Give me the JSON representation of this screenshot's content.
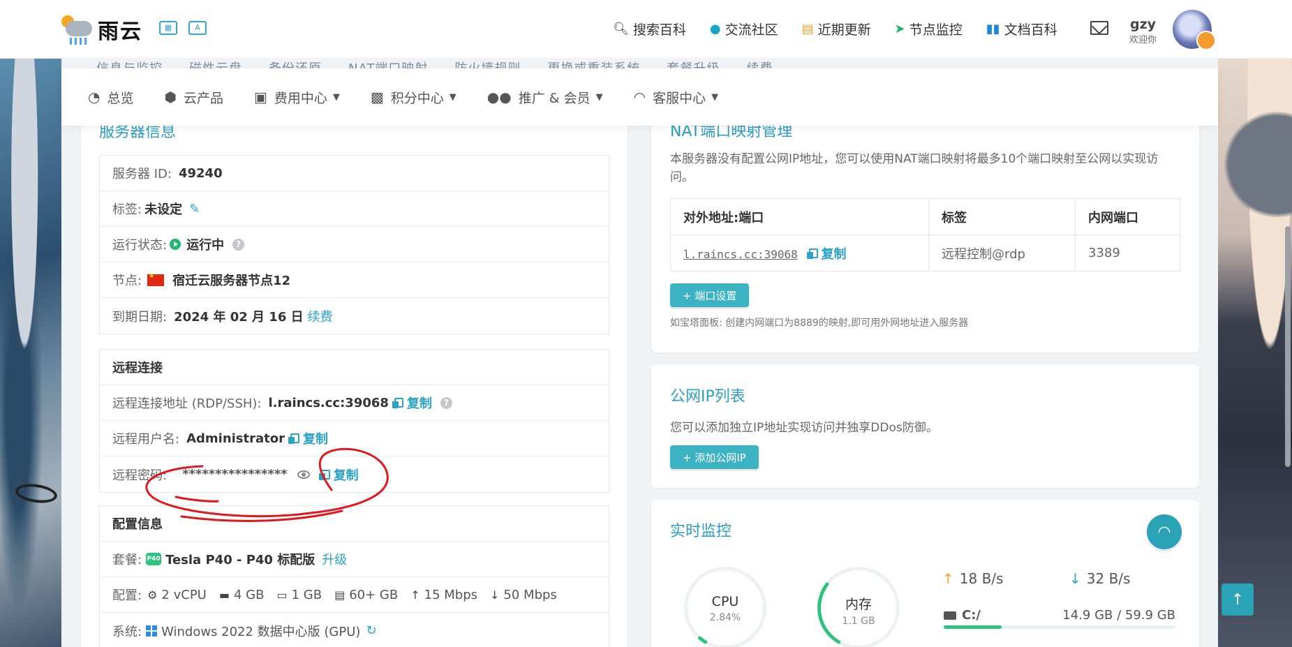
{
  "header": {
    "brand": "雨云",
    "nav": [
      {
        "label": "搜索百科",
        "icon": "search-icon"
      },
      {
        "label": "交流社区",
        "icon": "community-icon"
      },
      {
        "label": "近期更新",
        "icon": "update-icon"
      },
      {
        "label": "节点监控",
        "icon": "node-monitor-icon"
      },
      {
        "label": "文档百科",
        "icon": "book-icon"
      }
    ],
    "user": {
      "name": "gzy",
      "welcome": "欢迎你"
    }
  },
  "menubar": [
    {
      "label": "总览",
      "icon": "dashboard-icon",
      "dropdown": false
    },
    {
      "label": "云产品",
      "icon": "cubes-icon",
      "dropdown": false
    },
    {
      "label": "费用中心",
      "icon": "money-icon",
      "dropdown": true
    },
    {
      "label": "积分中心",
      "icon": "gift-icon",
      "dropdown": true
    },
    {
      "label": "推广 & 会员",
      "icon": "users-icon",
      "dropdown": true
    },
    {
      "label": "客服中心",
      "icon": "headset-icon",
      "dropdown": true
    }
  ],
  "hidden_tabs_text": "信息与监控　　磁性云盘　　备份还原　　NAT端口映射　　防火墙规则　　更换或重装系统　　套餐升级　　续费",
  "server_info": {
    "title": "服务器信息",
    "id_label": "服务器 ID:",
    "id_value": "49240",
    "tag_label": "标签:",
    "tag_value": "未设定",
    "status_label": "运行状态:",
    "status_value": "运行中",
    "node_label": "节点:",
    "node_value": "宿迁云服务器节点12",
    "expire_label": "到期日期:",
    "expire_value": "2024 年 02 月 16 日",
    "renew_label": "续费"
  },
  "remote": {
    "title": "远程连接",
    "address_label": "远程连接地址 (RDP/SSH):",
    "address_value": "l.raincs.cc:39068",
    "username_label": "远程用户名:",
    "username_value": "Administrator",
    "password_label": "远程密码:",
    "password_value": "****************",
    "copy_label": "复制"
  },
  "config": {
    "title": "配置信息",
    "plan_label": "套餐:",
    "plan_badge": "P40",
    "plan_value": "Tesla P40 - P40 标配版",
    "upgrade_label": "升级",
    "spec_label": "配置:",
    "specs": [
      "2 vCPU",
      "4 GB",
      "1 GB",
      "60+ GB",
      "15 Mbps",
      "50 Mbps"
    ],
    "os_label": "系统:",
    "os_value": "Windows 2022 数据中心版 (GPU)"
  },
  "nat": {
    "title": "NAT端口映射管理",
    "desc": "本服务器没有配置公网IP地址，您可以使用NAT端口映射将最多10个端口映射至公网以实现访问。",
    "columns": [
      "对外地址:端口",
      "标签",
      "内网端口"
    ],
    "rows": [
      {
        "addr": "l.raincs.cc:39068",
        "tag": "远程控制@rdp",
        "port": "3389"
      }
    ],
    "copy_label": "复制",
    "button": "+ 端口设置",
    "note": "如宝塔面板: 创建内网端口为8889的映射,即可用外网地址进入服务器"
  },
  "public_ip": {
    "title": "公网IP列表",
    "desc": "您可以添加独立IP地址实现访问并独享DDos防御。",
    "button": "+ 添加公网IP"
  },
  "monitor": {
    "title": "实时监控",
    "cpu_label": "CPU",
    "cpu_value": "2.84%",
    "cpu_fraction": 0.0284,
    "mem_label": "内存",
    "mem_value": "1.1 GB",
    "mem_fraction": 0.27,
    "up_speed": "18 B/s",
    "down_speed": "32 B/s",
    "disk_name": "C:/",
    "disk_usage": "14.9 GB / 59.9 GB",
    "disk_fraction": 0.249
  },
  "colors": {
    "accent": "#2aa3c6",
    "success": "#1fba6c",
    "warning": "#f0a030"
  }
}
